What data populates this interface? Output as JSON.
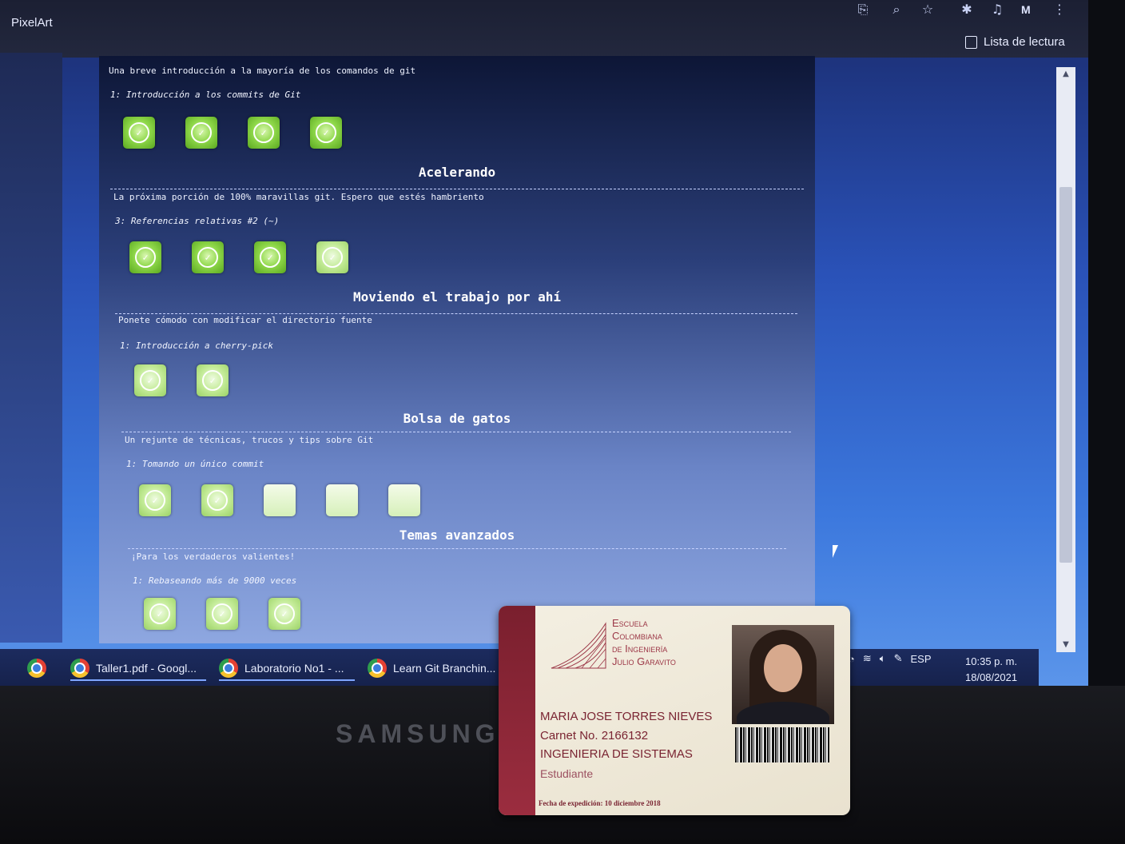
{
  "browser": {
    "tab_title": "PixelArt",
    "avatar_letter": "M",
    "reading_list_label": "Lista de lectura"
  },
  "content": {
    "intro_text": "Una breve introducción a la mayoría de los comandos de git",
    "sections": [
      {
        "title": "",
        "level_label": "1: Introducción a los commits de Git",
        "level_count": 4
      },
      {
        "title": "Acelerando",
        "description": "La próxima porción de 100% maravillas git. Espero que estés hambriento",
        "level_label": "3: Referencias relativas #2 (~)",
        "level_count": 4
      },
      {
        "title": "Moviendo el trabajo por ahí",
        "description": "Ponete cómodo con modificar el directorio fuente",
        "level_label": "1: Introducción a cherry-pick",
        "level_count": 2
      },
      {
        "title": "Bolsa de gatos",
        "description": "Un rejunte de técnicas, trucos y tips sobre Git",
        "level_label": "1: Tomando un único commit",
        "level_count": 5
      },
      {
        "title": "Temas avanzados",
        "description": "¡Para los verdaderos valientes!",
        "level_label": "1: Rebaseando más de 9000 veces",
        "level_count": 3
      }
    ]
  },
  "taskbar": {
    "items": [
      {
        "label": "Taller1.pdf - Googl..."
      },
      {
        "label": "Laboratorio No1 - ..."
      },
      {
        "label": "Learn Git Branchin..."
      }
    ],
    "language": "ESP",
    "time": "10:35 p. m.",
    "date": "18/08/2021"
  },
  "monitor": {
    "brand": "SAMSUNG"
  },
  "id_card": {
    "school_lines": [
      "Escuela",
      "Colombiana",
      "de Ingeniería",
      "Julio Garavito"
    ],
    "name": "MARIA JOSE TORRES NIEVES",
    "carnet": "Carnet No. 2166132",
    "program": "INGENIERIA DE SISTEMAS",
    "role": "Estudiante",
    "issue_date": "Fecha de expedición: 10 diciembre 2018"
  },
  "colors": {
    "level_complete": "#8fd84a",
    "card_accent": "#7a2432",
    "taskbar": "#1c2b5e"
  }
}
